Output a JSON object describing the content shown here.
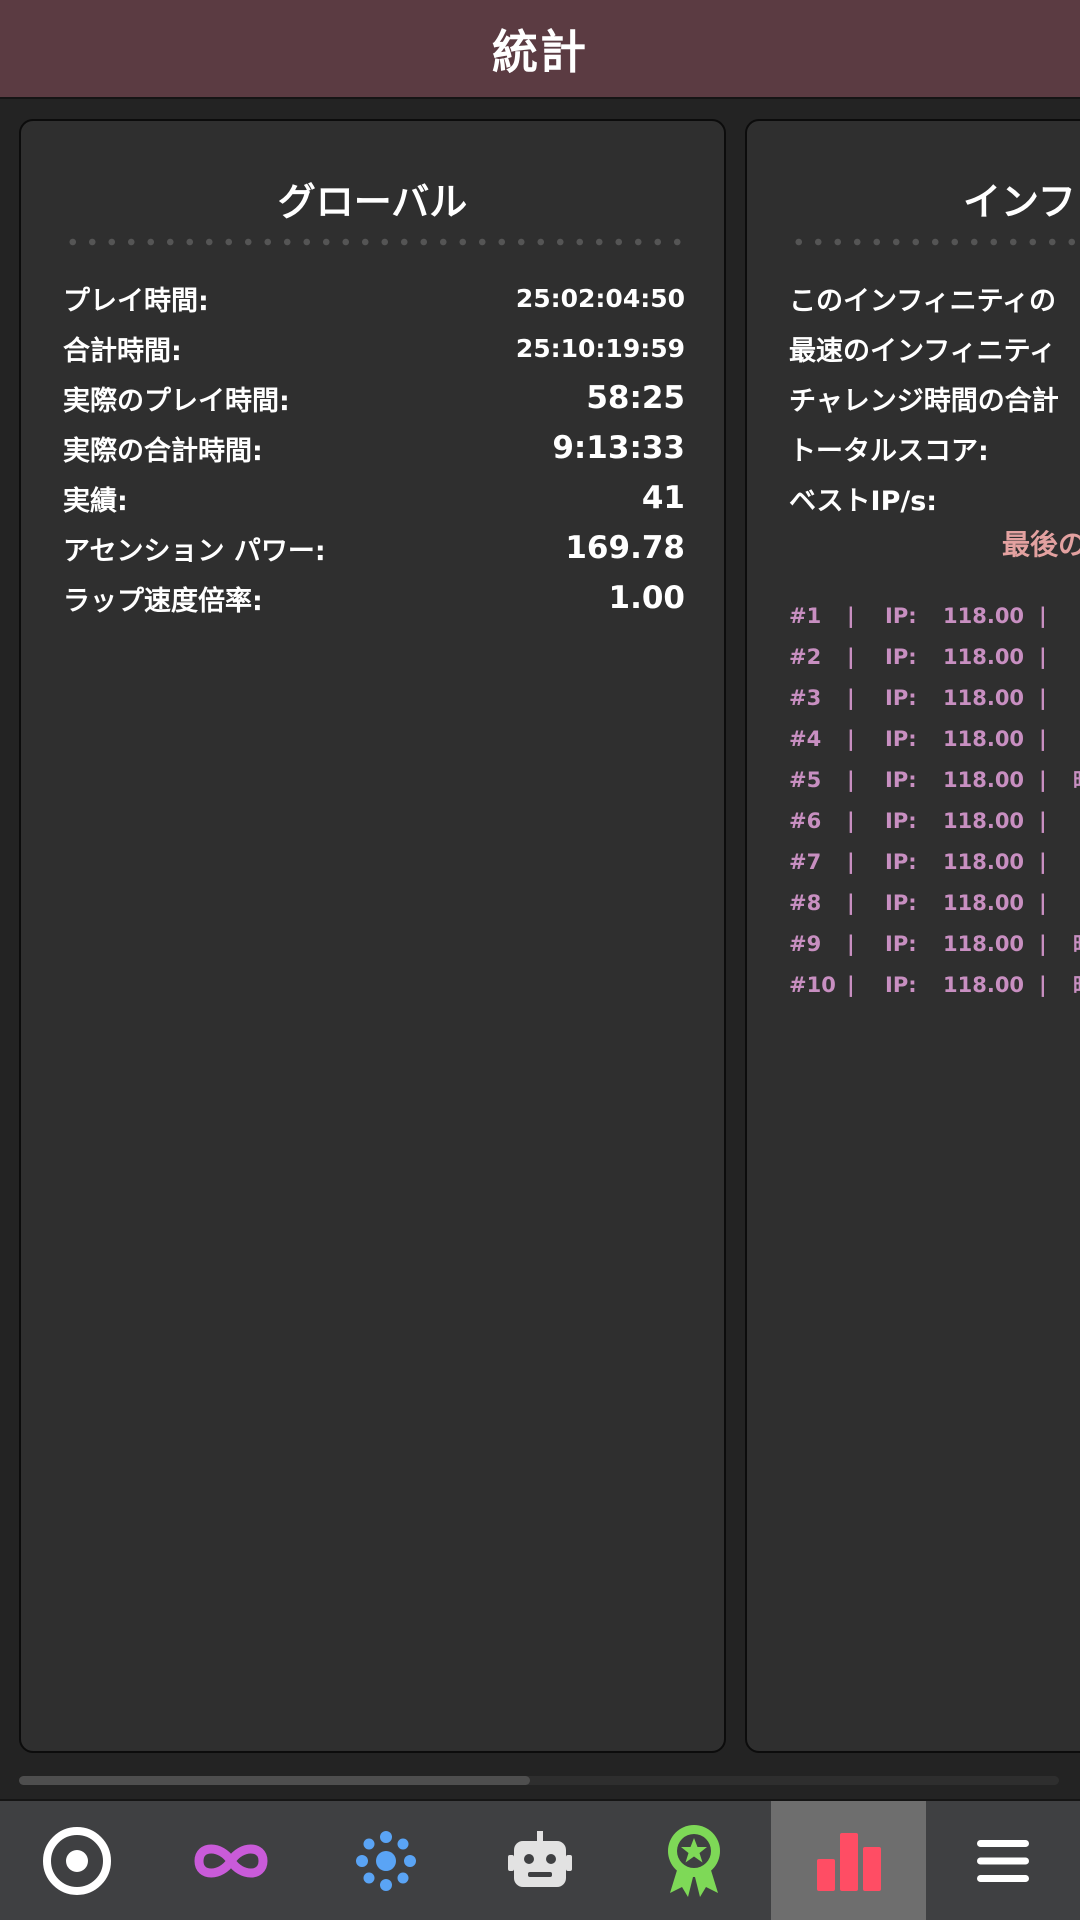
{
  "header": {
    "title": "統計"
  },
  "global": {
    "title": "グローバル",
    "stats": [
      {
        "label": "プレイ時間:",
        "value": "25:02:04:50"
      },
      {
        "label": "合計時間:",
        "value": "25:10:19:59"
      },
      {
        "label": "実際のプレイ時間:",
        "value": "58:25"
      },
      {
        "label": "実際の合計時間:",
        "value": "9:13:33"
      },
      {
        "label": "実績:",
        "value": "41"
      },
      {
        "label": "アセンション パワー:",
        "value": "169.78"
      },
      {
        "label": "ラップ速度倍率:",
        "value": "1.00"
      }
    ]
  },
  "infinity": {
    "title": "インフ",
    "stats": [
      {
        "label": "このインフィニティの"
      },
      {
        "label": "最速のインフィニティ"
      },
      {
        "label": "チャレンジ時間の合計"
      },
      {
        "label": "トータルスコア:"
      },
      {
        "label": "ベストIP/s:"
      }
    ],
    "last_title": "最後の",
    "runs": [
      {
        "num": "#1",
        "sep": "|",
        "ip_label": "IP:",
        "ip": "118.00",
        "sep2": "|",
        "time_label": ""
      },
      {
        "num": "#2",
        "sep": "|",
        "ip_label": "IP:",
        "ip": "118.00",
        "sep2": "|",
        "time_label": ""
      },
      {
        "num": "#3",
        "sep": "|",
        "ip_label": "IP:",
        "ip": "118.00",
        "sep2": "|",
        "time_label": ""
      },
      {
        "num": "#4",
        "sep": "|",
        "ip_label": "IP:",
        "ip": "118.00",
        "sep2": "|",
        "time_label": ""
      },
      {
        "num": "#5",
        "sep": "|",
        "ip_label": "IP:",
        "ip": "118.00",
        "sep2": "|",
        "time_label": "時"
      },
      {
        "num": "#6",
        "sep": "|",
        "ip_label": "IP:",
        "ip": "118.00",
        "sep2": "|",
        "time_label": ""
      },
      {
        "num": "#7",
        "sep": "|",
        "ip_label": "IP:",
        "ip": "118.00",
        "sep2": "|",
        "time_label": ""
      },
      {
        "num": "#8",
        "sep": "|",
        "ip_label": "IP:",
        "ip": "118.00",
        "sep2": "|",
        "time_label": ""
      },
      {
        "num": "#9",
        "sep": "|",
        "ip_label": "IP:",
        "ip": "118.00",
        "sep2": "|",
        "time_label": "時"
      },
      {
        "num": "#10",
        "sep": "|",
        "ip_label": "IP:",
        "ip": "118.00",
        "sep2": "|",
        "time_label": "時"
      }
    ]
  },
  "nav": {
    "items": [
      {
        "icon": "target-icon",
        "color": "#ffffff",
        "active": false
      },
      {
        "icon": "infinity-icon",
        "color": "#c95bd9",
        "active": false
      },
      {
        "icon": "dots-cluster-icon",
        "color": "#5aa4f5",
        "active": false
      },
      {
        "icon": "robot-icon",
        "color": "#e2e2e2",
        "active": false
      },
      {
        "icon": "award-ribbon-icon",
        "color": "#7ed957",
        "active": false
      },
      {
        "icon": "bar-chart-icon",
        "color": "#ff4d64",
        "active": true
      },
      {
        "icon": "menu-icon",
        "color": "#ffffff",
        "active": false
      }
    ]
  },
  "colors": {
    "header_bg": "#5b3b42",
    "panel_bg": "#2f2f2f",
    "run_text": "#c88fc1",
    "last_title": "#e3a1a0"
  }
}
